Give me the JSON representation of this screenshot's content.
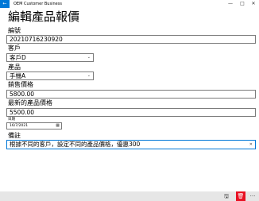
{
  "titlebar": {
    "back_icon": "←",
    "app_title": "OEM Customer Business",
    "minimize_glyph": "—",
    "maximize_glyph": "□",
    "close_glyph": "✕"
  },
  "page": {
    "title": "編輯產品報價"
  },
  "form": {
    "number_label": "編號",
    "number_value": "20210716230920",
    "customer_label": "客戶",
    "customer_selected": "客戶D",
    "product_label": "產品",
    "product_selected": "手機A",
    "sale_price_label": "銷售價格",
    "sale_price_value": "5800.00",
    "latest_price_label": "最新的產品價格",
    "latest_price_value": "5500.00",
    "date_label": "日期",
    "date_value": "16/7/2021",
    "note_label": "備註",
    "note_value": "根據不同的客戶，設定不同的產品價格，優惠300"
  },
  "bottombar": {
    "save_glyph": "🖫",
    "delete_glyph": "🗑",
    "more_glyph": "···"
  },
  "colors": {
    "accent": "#0078d7",
    "delete": "#e81123",
    "bar": "#e6e6e6"
  }
}
